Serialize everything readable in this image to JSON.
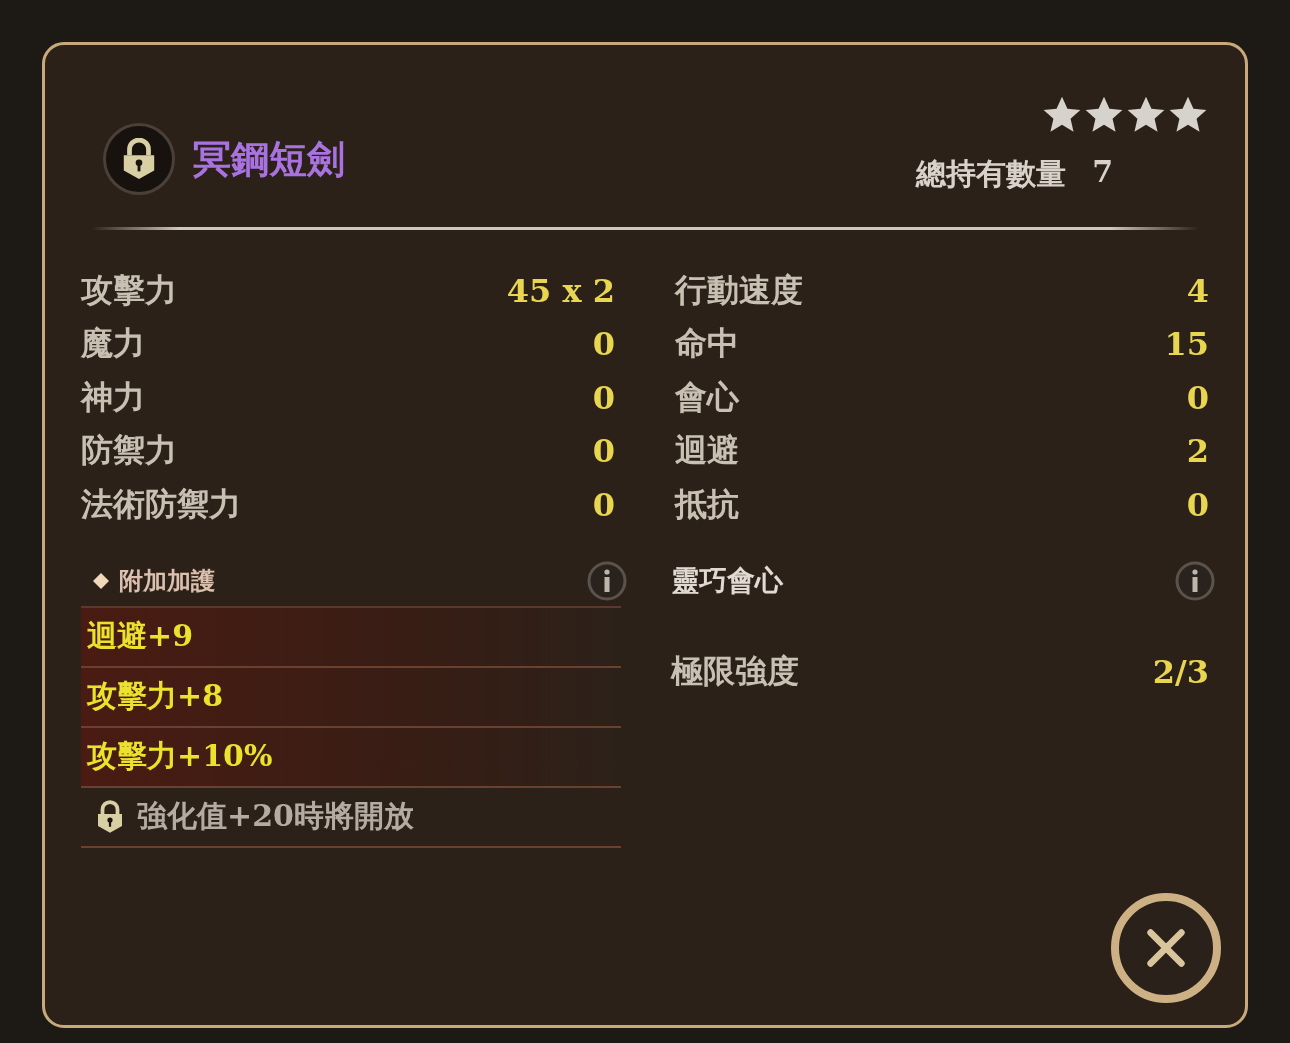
{
  "item": {
    "name": "冥鋼短劍",
    "locked": true,
    "stars": 4,
    "total_label": "總持有數量",
    "total_value": "7"
  },
  "stats_left": [
    {
      "label": "攻擊力",
      "value": "45 x 2"
    },
    {
      "label": "魔力",
      "value": "0"
    },
    {
      "label": "神力",
      "value": "0"
    },
    {
      "label": "防禦力",
      "value": "0"
    },
    {
      "label": "法術防禦力",
      "value": "0"
    }
  ],
  "stats_right": [
    {
      "label": "行動速度",
      "value": "4"
    },
    {
      "label": "命中",
      "value": "15"
    },
    {
      "label": "會心",
      "value": "0"
    },
    {
      "label": "迴避",
      "value": "2"
    },
    {
      "label": "抵抗",
      "value": "0"
    }
  ],
  "bonus": {
    "title": "附加加護",
    "items": [
      {
        "kind": "bonus",
        "text": "迴避+9"
      },
      {
        "kind": "bonus",
        "text": "攻擊力+8"
      },
      {
        "kind": "bonus",
        "text": "攻擊力+10%"
      },
      {
        "kind": "locked",
        "text": "強化值+20時將開放"
      }
    ]
  },
  "skill": {
    "name": "靈巧會心",
    "limit_label": "極限強度",
    "limit_value": "2/3"
  }
}
